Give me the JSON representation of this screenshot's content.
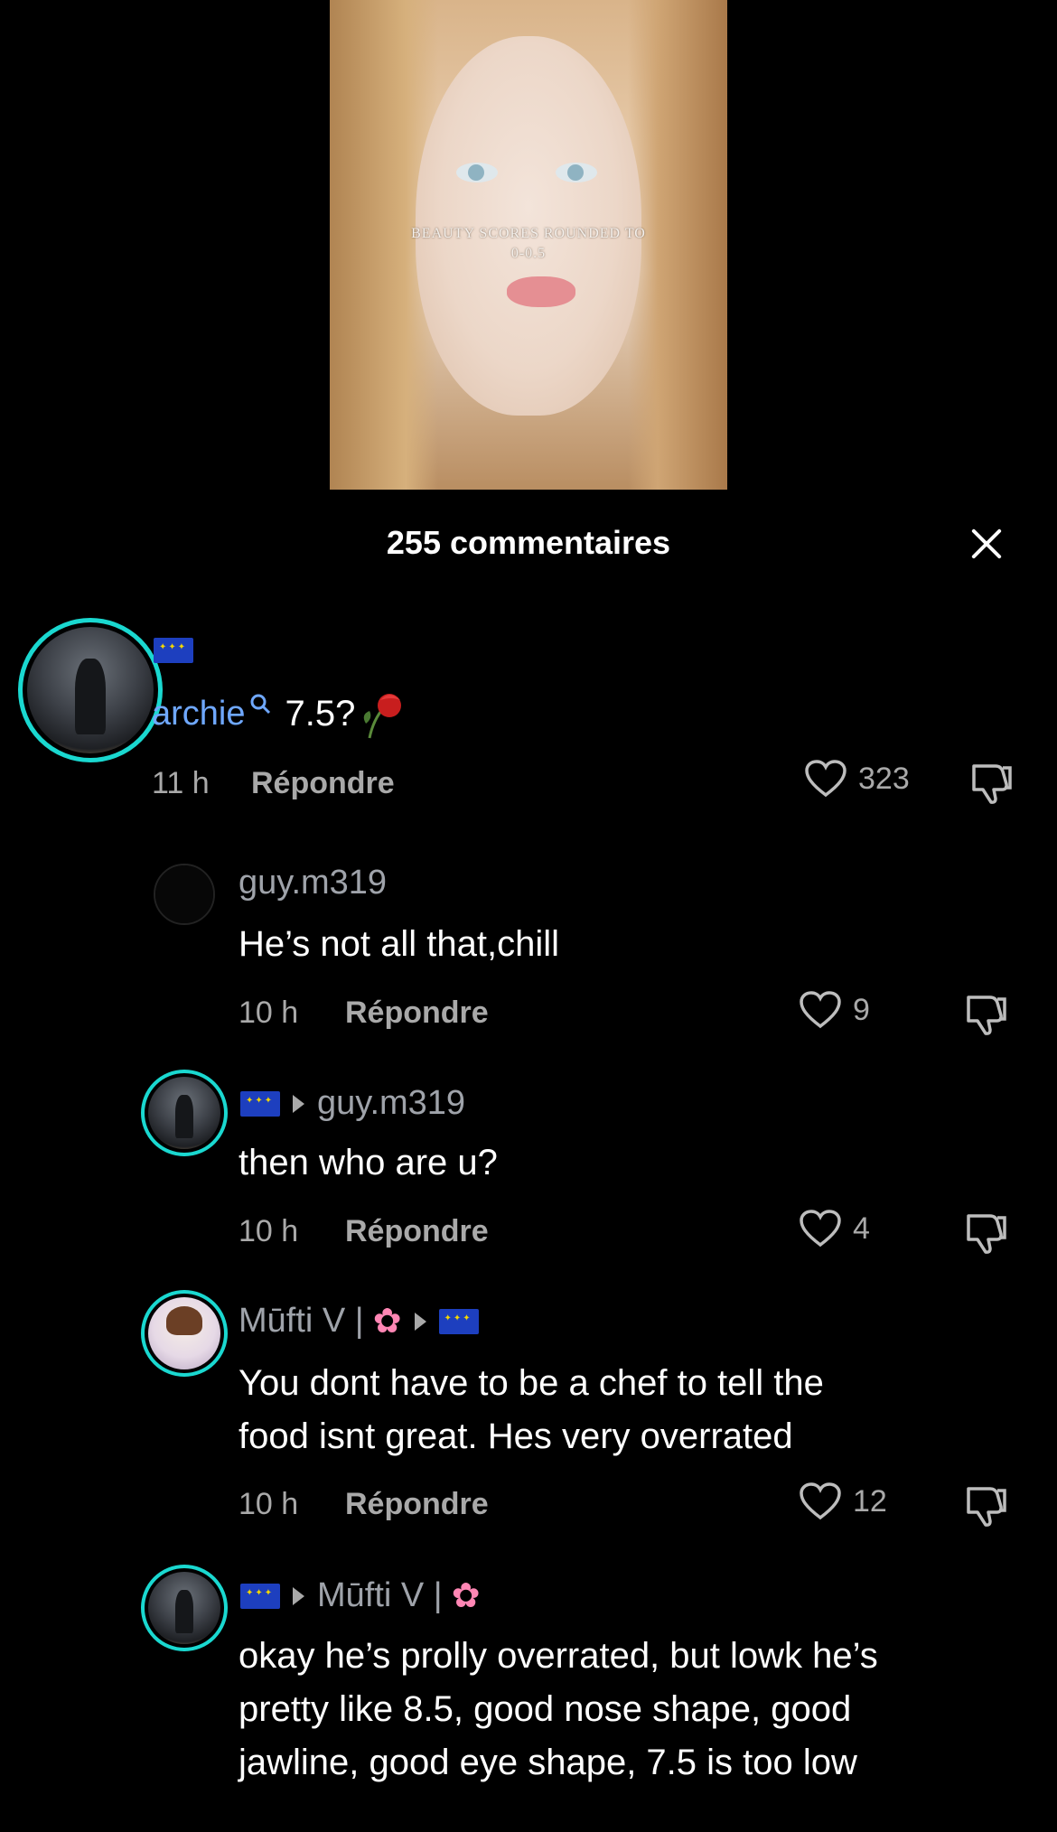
{
  "video": {
    "caption_line1": "BEAUTY SCORES ROUNDED TO",
    "caption_line2": "0-0.5"
  },
  "header": {
    "title": "255 commentaires"
  },
  "comments": [
    {
      "username": "archie",
      "text": "7.5?",
      "time": "11 h",
      "reply": "Répondre",
      "likes": "323"
    },
    {
      "username": "guy.m319",
      "text": "He’s not all that,chill",
      "time": "10 h",
      "reply": "Répondre",
      "likes": "9"
    },
    {
      "reply_to": "guy.m319",
      "text": "then who are u?",
      "time": "10 h",
      "reply": "Répondre",
      "likes": "4"
    },
    {
      "username": "Mūfti V |",
      "text_line1": "You dont have to be a chef to tell the",
      "text_line2": "food isnt great. Hes very overrated",
      "time": "10 h",
      "reply": "Répondre",
      "likes": "12"
    },
    {
      "reply_to": "Mūfti V |",
      "text_line1": "okay he’s prolly overrated, but lowk he’s",
      "text_line2": "pretty like 8.5, good nose shape, good",
      "text_line3": "jawline, good eye shape, 7.5 is too low"
    }
  ],
  "icons": [
    "eu-flag-icon",
    "search-icon",
    "rose-icon",
    "heart-icon",
    "dislike-icon",
    "close-icon",
    "flower-icon",
    "reply-arrow-icon"
  ]
}
